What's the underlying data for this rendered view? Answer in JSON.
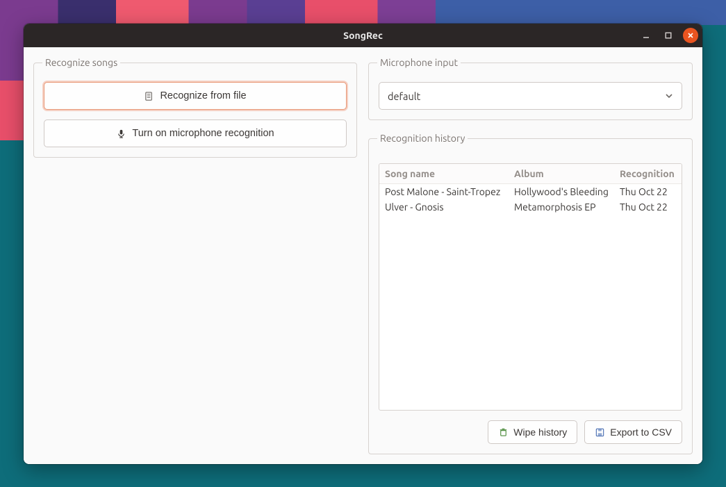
{
  "window": {
    "title": "SongRec"
  },
  "recognize": {
    "legend": "Recognize songs",
    "from_file": "Recognize from file",
    "turn_on_mic": "Turn on microphone recognition"
  },
  "mic_input": {
    "legend": "Microphone input",
    "selected": "default"
  },
  "history": {
    "legend": "Recognition history",
    "columns": {
      "song": "Song name",
      "album": "Album",
      "date": "Recognition"
    },
    "rows": [
      {
        "song": "Post Malone - Saint-Tropez",
        "album": "Hollywood's Bleeding",
        "date": "Thu Oct 22"
      },
      {
        "song": "Ulver - Gnosis",
        "album": "Metamorphosis EP",
        "date": "Thu Oct 22"
      }
    ],
    "wipe": "Wipe history",
    "export": "Export to CSV"
  }
}
